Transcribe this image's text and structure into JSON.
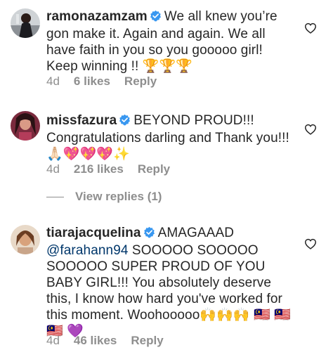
{
  "comments": [
    {
      "username": "ramonazamzam",
      "text": "We all knew you’re gon make it. Again and again. We all have faith in you so you gooooo girl! Keep winning !! 🏆🏆🏆",
      "age": "4d",
      "likes": "6 likes",
      "reply": "Reply"
    },
    {
      "username": "missfazura",
      "text": "BEYOND PROUD!!! Congratulations darling and Thank you!!! 🙏🏻💖💖💖✨",
      "age": "4d",
      "likes": "216 likes",
      "reply": "Reply"
    },
    {
      "username": "tiarajacquelina",
      "text_prefix": "AMAGAAAD",
      "mention": "@farahann94",
      "text": "SOOOOO SOOOOO SOOOOO SUPER PROUD OF YOU BABY GIRL!!! You absolutely deserve this, I know how hard you've worked for this moment. Woohooooo🙌🙌🙌 🇲🇾 🇲🇾 🇲🇾 💜",
      "age": "4d",
      "likes": "46 likes",
      "reply": "Reply"
    }
  ],
  "view_replies": "View replies (1)",
  "colors": {
    "text": "#262626",
    "secondary": "#8e8e8e",
    "verified": "#3897f0",
    "mention": "#00376b"
  },
  "icons": {
    "verified": "verified-badge-icon",
    "like": "heart-outline-icon"
  }
}
